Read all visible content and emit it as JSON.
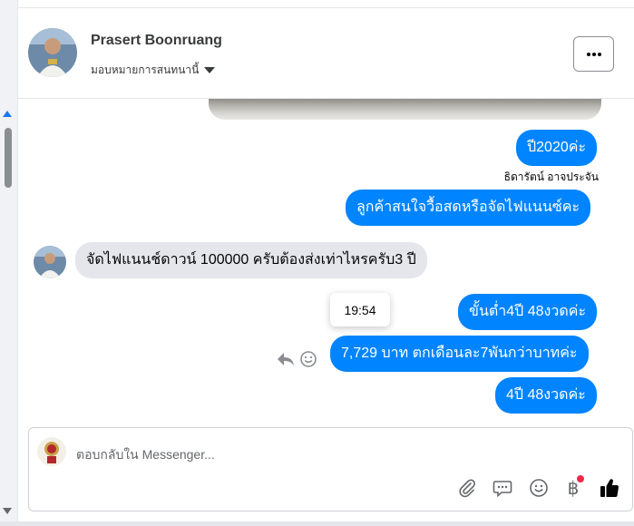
{
  "header": {
    "contact_name": "Prasert Boonruang",
    "assign_label": "มอบหมายการสนทนานี้",
    "more_label": "···"
  },
  "messages": [
    {
      "direction": "outgoing",
      "text": "ปี2020ค่ะ"
    },
    {
      "direction": "outgoing",
      "sender": "ธิดารัตน์ อาจประจัน",
      "text": "ลูกค้าสนใจวื้อสดหรือจัดไฟแนนซ์คะ"
    },
    {
      "direction": "incoming",
      "text": "จัดไฟแนนช์ดาวน์ 100000 ครับต้องส่งเท่าไหรครับ3 ปี"
    },
    {
      "direction": "outgoing",
      "text": "ขั้นต่ำ4ปี 48งวดค่ะ"
    },
    {
      "direction": "outgoing",
      "text": "7,729 บาท ตกเดือนละ7พันกว่าบาทค่ะ"
    },
    {
      "direction": "outgoing",
      "text": "4ปี 48งวดค่ะ"
    }
  ],
  "tooltip": {
    "time": "19:54"
  },
  "composer": {
    "placeholder": "ตอบกลับใน Messenger..."
  },
  "icons": {
    "more": "ellipsis-icon",
    "reply": "reply-icon",
    "react": "smiley-icon",
    "attach": "paperclip-icon",
    "saved_replies": "chat-bubble-icon",
    "emoji": "emoji-icon",
    "payment": "baht-icon",
    "like": "thumbs-up-icon"
  },
  "colors": {
    "outgoing_bubble": "#0084ff",
    "incoming_bubble": "#e4e6eb",
    "accent": "#1877f2",
    "notification_dot": "#f02849"
  }
}
